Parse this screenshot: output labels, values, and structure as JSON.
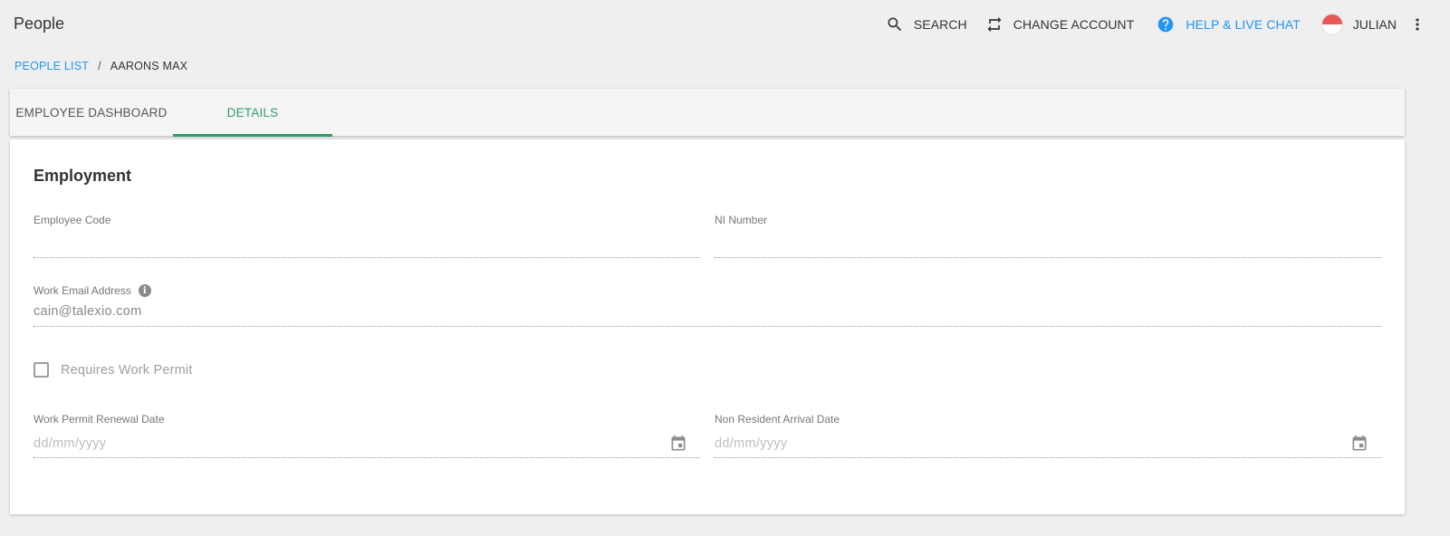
{
  "app": {
    "title": "People"
  },
  "header": {
    "search_label": "SEARCH",
    "change_account_label": "CHANGE ACCOUNT",
    "help_label": "HELP & LIVE CHAT",
    "user_name": "JULIAN",
    "accent_color": "#2196f3"
  },
  "breadcrumb": {
    "parent": "PEOPLE LIST",
    "separator": "/",
    "current": "AARONS MAX"
  },
  "tabs": [
    {
      "label": "EMPLOYEE DASHBOARD",
      "active": false
    },
    {
      "label": "DETAILS",
      "active": true
    }
  ],
  "tab_active_color": "#2e9e69",
  "employment": {
    "title": "Employment",
    "employee_code": {
      "label": "Employee Code",
      "value": ""
    },
    "ni_number": {
      "label": "NI Number",
      "value": ""
    },
    "work_email": {
      "label": "Work Email Address",
      "value": "cain@talexio.com",
      "info_icon": "info-icon"
    },
    "requires_work_permit": {
      "label": "Requires Work Permit",
      "checked": false
    },
    "work_permit_renewal_date": {
      "label": "Work Permit Renewal Date",
      "placeholder": "dd/mm/yyyy"
    },
    "non_resident_arrival_date": {
      "label": "Non Resident Arrival Date",
      "placeholder": "dd/mm/yyyy"
    }
  }
}
